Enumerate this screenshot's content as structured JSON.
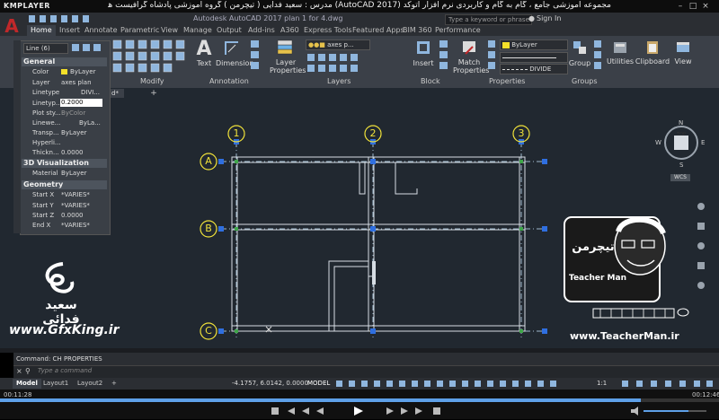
{
  "player": {
    "logo": "KMPLAYER",
    "title": "مجموعه آموزشی جامع ، گام به گام و کاربردی نرم افزار اتوکد (AutoCAD 2017) مدرس : سعید فدایی ( تیچرمن ) گروه آموزشی پادشاه گرافیست ها",
    "time_elapsed": "00:11:28",
    "time_total": "00:12:46"
  },
  "app": {
    "logo": "A",
    "title": "Autodesk AutoCAD 2017   plan 1 for 4.dwg",
    "search_placeholder": "Type a keyword or phrase",
    "sign_in": "Sign In"
  },
  "tabs": [
    "Home",
    "Insert",
    "Annotate",
    "Parametric",
    "View",
    "Manage",
    "Output",
    "Add-ins",
    "A360",
    "Express Tools",
    "Featured Apps",
    "BIM 360",
    "Performance"
  ],
  "ribbon": {
    "modify_label": "Modify",
    "text_label": "Text",
    "dimension_label": "Dimension",
    "annotation_label": "Annotation",
    "layer_props_label": "Layer Properties",
    "layer_value": "axes p...",
    "layers_label": "Layers",
    "insert_label": "Insert",
    "block_label": "Block",
    "match_props_label": "Match Properties",
    "bylayer_color": "ByLayer",
    "linetype_value": "DIVIDE",
    "properties_label": "Properties",
    "group_label": "Group",
    "groups_label": "Groups",
    "utilities_label": "Utilities",
    "clipboard_label": "Clipboard",
    "view_label": "View"
  },
  "props": {
    "selection": "Line (6)",
    "general": "General",
    "rows_general": [
      {
        "k": "Color",
        "v": "ByLayer"
      },
      {
        "k": "Layer",
        "v": "axes plan"
      },
      {
        "k": "Linetype",
        "v": "DIVI..."
      },
      {
        "k": "Linetyp...",
        "v": "0.2000"
      },
      {
        "k": "Plot sty...",
        "v": "ByColor"
      },
      {
        "k": "Linewe...",
        "v": "ByLa..."
      },
      {
        "k": "Transp...",
        "v": "ByLayer"
      },
      {
        "k": "Hyperli...",
        "v": ""
      },
      {
        "k": "Thickn...",
        "v": "0.0000"
      }
    ],
    "viz": "3D Visualization",
    "material": {
      "k": "Material",
      "v": "ByLayer"
    },
    "geometry": "Geometry",
    "rows_geom": [
      {
        "k": "Start X",
        "v": "*VARIES*"
      },
      {
        "k": "Start Y",
        "v": "*VARIES*"
      },
      {
        "k": "Start Z",
        "v": "0.0000"
      },
      {
        "k": "End X",
        "v": "*VARIES*"
      }
    ]
  },
  "drawing": {
    "tab_label": "d*",
    "grid_cols": [
      "1",
      "2",
      "3"
    ],
    "grid_rows": [
      "A",
      "B",
      "C"
    ],
    "viewcube": {
      "n": "N",
      "s": "S",
      "e": "E",
      "w": "W",
      "top": "TOP",
      "wcs": "WCS"
    }
  },
  "watermark": {
    "name_fa": "سعید فدائی",
    "site1": "www.GfxKing.ir",
    "site2": "www.TeacherMan.ir",
    "brand": "Teacher Man",
    "brand_fa": "تیچرمن"
  },
  "command": {
    "history": "Command: CH PROPERTIES",
    "placeholder": "Type a command"
  },
  "status": {
    "layout_tabs": [
      "Model",
      "Layout1",
      "Layout2"
    ],
    "coords": "-4.1757, 6.0142, 0.0000",
    "model": "MODEL",
    "scale": "1:1"
  }
}
